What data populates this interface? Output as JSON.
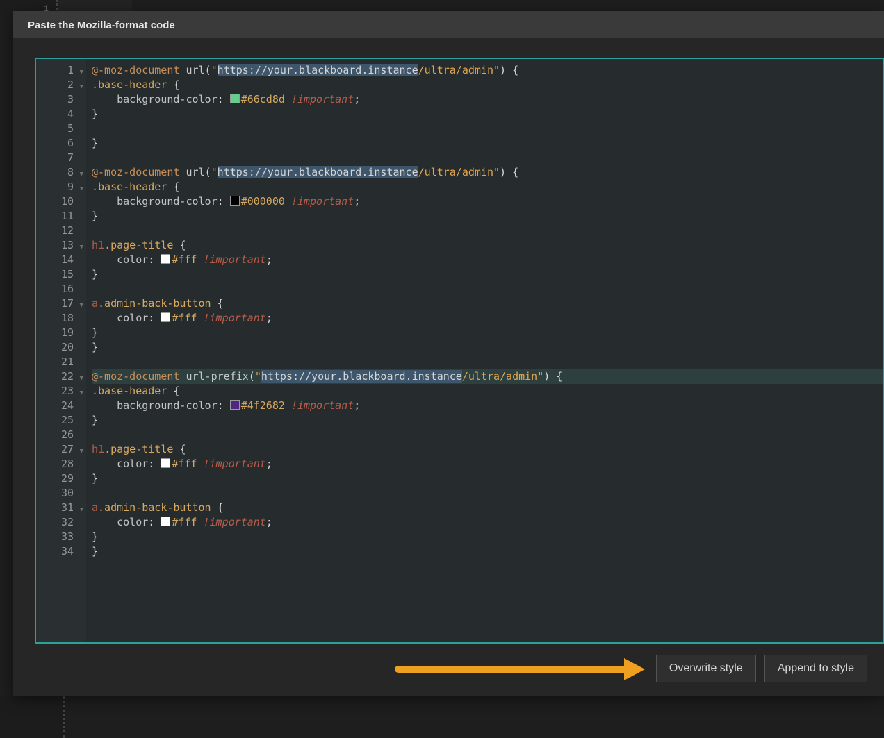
{
  "bg": {
    "line_no": "1"
  },
  "dialog": {
    "title": "Paste the Mozilla-format code",
    "buttons": {
      "overwrite": "Overwrite style",
      "append": "Append to style"
    }
  },
  "editor": {
    "line_count": 34,
    "active_line": 22,
    "fold_lines": [
      1,
      2,
      8,
      9,
      13,
      17,
      22,
      23,
      27,
      31
    ],
    "lines": [
      {
        "n": 1,
        "parts": [
          {
            "t": "atrule",
            "v": "@-moz-document"
          },
          {
            "t": "sp"
          },
          {
            "t": "fn",
            "v": "url"
          },
          {
            "t": "punc",
            "v": "("
          },
          {
            "t": "string",
            "v": "\""
          },
          {
            "t": "string",
            "v": "https://",
            "sel": true
          },
          {
            "t": "string",
            "v": "your.blackboard.instance",
            "sel": true
          },
          {
            "t": "string",
            "v": "/ultra/admin"
          },
          {
            "t": "string",
            "v": "\""
          },
          {
            "t": "punc",
            "v": ")"
          },
          {
            "t": "sp"
          },
          {
            "t": "punc",
            "v": "{"
          }
        ]
      },
      {
        "n": 2,
        "parts": [
          {
            "t": "sel-class",
            "v": ".base-header"
          },
          {
            "t": "sp"
          },
          {
            "t": "punc",
            "v": "{"
          }
        ]
      },
      {
        "n": 3,
        "parts": [
          {
            "t": "indent",
            "v": "    "
          },
          {
            "t": "prop",
            "v": "background-color"
          },
          {
            "t": "punc",
            "v": ": "
          },
          {
            "t": "swatch",
            "c": "#66cd8d"
          },
          {
            "t": "color",
            "v": "#66cd8d"
          },
          {
            "t": "sp"
          },
          {
            "t": "imp",
            "v": "!important"
          },
          {
            "t": "punc",
            "v": ";"
          }
        ]
      },
      {
        "n": 4,
        "parts": [
          {
            "t": "punc",
            "v": "}"
          }
        ]
      },
      {
        "n": 5,
        "parts": []
      },
      {
        "n": 6,
        "parts": [
          {
            "t": "punc",
            "v": "}"
          }
        ]
      },
      {
        "n": 7,
        "parts": []
      },
      {
        "n": 8,
        "parts": [
          {
            "t": "atrule",
            "v": "@-moz-document"
          },
          {
            "t": "sp"
          },
          {
            "t": "fn",
            "v": "url"
          },
          {
            "t": "punc",
            "v": "("
          },
          {
            "t": "string",
            "v": "\""
          },
          {
            "t": "string",
            "v": "https://",
            "sel": true
          },
          {
            "t": "string",
            "v": "your.blackboard.instance",
            "sel": true
          },
          {
            "t": "string",
            "v": "/ultra/admin"
          },
          {
            "t": "string",
            "v": "\""
          },
          {
            "t": "punc",
            "v": ")"
          },
          {
            "t": "sp"
          },
          {
            "t": "punc",
            "v": "{"
          }
        ]
      },
      {
        "n": 9,
        "parts": [
          {
            "t": "sel-class",
            "v": ".base-header"
          },
          {
            "t": "sp"
          },
          {
            "t": "punc",
            "v": "{"
          }
        ]
      },
      {
        "n": 10,
        "parts": [
          {
            "t": "indent",
            "v": "    "
          },
          {
            "t": "prop",
            "v": "background-color"
          },
          {
            "t": "punc",
            "v": ": "
          },
          {
            "t": "swatch",
            "c": "#000000"
          },
          {
            "t": "color",
            "v": "#000000"
          },
          {
            "t": "sp"
          },
          {
            "t": "imp",
            "v": "!important"
          },
          {
            "t": "punc",
            "v": ";"
          }
        ]
      },
      {
        "n": 11,
        "parts": [
          {
            "t": "punc",
            "v": "}"
          }
        ]
      },
      {
        "n": 12,
        "parts": []
      },
      {
        "n": 13,
        "parts": [
          {
            "t": "sel-tag",
            "v": "h1"
          },
          {
            "t": "sel-class",
            "v": ".page-title"
          },
          {
            "t": "sp"
          },
          {
            "t": "punc",
            "v": "{"
          }
        ]
      },
      {
        "n": 14,
        "parts": [
          {
            "t": "indent",
            "v": "    "
          },
          {
            "t": "prop",
            "v": "color"
          },
          {
            "t": "punc",
            "v": ": "
          },
          {
            "t": "swatch",
            "c": "#ffffff"
          },
          {
            "t": "color",
            "v": "#fff"
          },
          {
            "t": "sp"
          },
          {
            "t": "imp",
            "v": "!important"
          },
          {
            "t": "punc",
            "v": ";"
          }
        ]
      },
      {
        "n": 15,
        "parts": [
          {
            "t": "punc",
            "v": "}"
          }
        ]
      },
      {
        "n": 16,
        "parts": []
      },
      {
        "n": 17,
        "parts": [
          {
            "t": "sel-tag",
            "v": "a"
          },
          {
            "t": "sel-class",
            "v": ".admin-back-button"
          },
          {
            "t": "sp"
          },
          {
            "t": "punc",
            "v": "{"
          }
        ]
      },
      {
        "n": 18,
        "parts": [
          {
            "t": "indent",
            "v": "    "
          },
          {
            "t": "prop",
            "v": "color"
          },
          {
            "t": "punc",
            "v": ": "
          },
          {
            "t": "swatch",
            "c": "#ffffff"
          },
          {
            "t": "color",
            "v": "#fff"
          },
          {
            "t": "sp"
          },
          {
            "t": "imp",
            "v": "!important"
          },
          {
            "t": "punc",
            "v": ";"
          }
        ]
      },
      {
        "n": 19,
        "parts": [
          {
            "t": "punc",
            "v": "}"
          }
        ]
      },
      {
        "n": 20,
        "parts": [
          {
            "t": "punc",
            "v": "}"
          }
        ]
      },
      {
        "n": 21,
        "parts": []
      },
      {
        "n": 22,
        "parts": [
          {
            "t": "atrule",
            "v": "@-moz-document"
          },
          {
            "t": "sp"
          },
          {
            "t": "fn",
            "v": "url-prefix"
          },
          {
            "t": "punc",
            "v": "("
          },
          {
            "t": "string",
            "v": "\""
          },
          {
            "t": "string",
            "v": "https://",
            "sel": true
          },
          {
            "t": "string",
            "v": "your.blackboard.instance",
            "sel": true
          },
          {
            "t": "string",
            "v": "/ultra/admin"
          },
          {
            "t": "string",
            "v": "\""
          },
          {
            "t": "punc",
            "v": ")"
          },
          {
            "t": "sp"
          },
          {
            "t": "punc",
            "v": "{"
          }
        ]
      },
      {
        "n": 23,
        "parts": [
          {
            "t": "sel-class",
            "v": ".base-header"
          },
          {
            "t": "sp"
          },
          {
            "t": "punc",
            "v": "{"
          }
        ]
      },
      {
        "n": 24,
        "parts": [
          {
            "t": "indent",
            "v": "    "
          },
          {
            "t": "prop",
            "v": "background-color"
          },
          {
            "t": "punc",
            "v": ": "
          },
          {
            "t": "swatch",
            "c": "#4f2682"
          },
          {
            "t": "color",
            "v": "#4f2682"
          },
          {
            "t": "sp"
          },
          {
            "t": "imp",
            "v": "!important"
          },
          {
            "t": "punc",
            "v": ";"
          }
        ]
      },
      {
        "n": 25,
        "parts": [
          {
            "t": "punc",
            "v": "}"
          }
        ]
      },
      {
        "n": 26,
        "parts": []
      },
      {
        "n": 27,
        "parts": [
          {
            "t": "sel-tag",
            "v": "h1"
          },
          {
            "t": "sel-class",
            "v": ".page-title"
          },
          {
            "t": "sp"
          },
          {
            "t": "punc",
            "v": "{"
          }
        ]
      },
      {
        "n": 28,
        "parts": [
          {
            "t": "indent",
            "v": "    "
          },
          {
            "t": "prop",
            "v": "color"
          },
          {
            "t": "punc",
            "v": ": "
          },
          {
            "t": "swatch",
            "c": "#ffffff"
          },
          {
            "t": "color",
            "v": "#fff"
          },
          {
            "t": "sp"
          },
          {
            "t": "imp",
            "v": "!important"
          },
          {
            "t": "punc",
            "v": ";"
          }
        ]
      },
      {
        "n": 29,
        "parts": [
          {
            "t": "punc",
            "v": "}"
          }
        ]
      },
      {
        "n": 30,
        "parts": []
      },
      {
        "n": 31,
        "parts": [
          {
            "t": "sel-tag",
            "v": "a"
          },
          {
            "t": "sel-class",
            "v": ".admin-back-button"
          },
          {
            "t": "sp"
          },
          {
            "t": "punc",
            "v": "{"
          }
        ]
      },
      {
        "n": 32,
        "parts": [
          {
            "t": "indent",
            "v": "    "
          },
          {
            "t": "prop",
            "v": "color"
          },
          {
            "t": "punc",
            "v": ": "
          },
          {
            "t": "swatch",
            "c": "#ffffff"
          },
          {
            "t": "color",
            "v": "#fff"
          },
          {
            "t": "sp"
          },
          {
            "t": "imp",
            "v": "!important"
          },
          {
            "t": "punc",
            "v": ";"
          }
        ]
      },
      {
        "n": 33,
        "parts": [
          {
            "t": "punc",
            "v": "}"
          }
        ]
      },
      {
        "n": 34,
        "parts": [
          {
            "t": "punc",
            "v": "}"
          }
        ]
      }
    ]
  }
}
